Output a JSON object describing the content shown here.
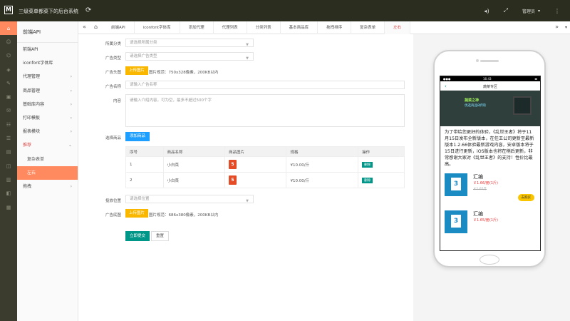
{
  "header": {
    "title": "三级菜单都菜下的后台系统",
    "user": "管理员"
  },
  "menu": {
    "heading": "前端API",
    "items": [
      {
        "label": "前端API",
        "chevron": false,
        "style": ""
      },
      {
        "label": "iconfont字体库",
        "chevron": false,
        "style": ""
      },
      {
        "label": "代理管理",
        "chevron": true,
        "style": ""
      },
      {
        "label": "商品管理",
        "chevron": true,
        "style": ""
      },
      {
        "label": "基础库内容",
        "chevron": true,
        "style": ""
      },
      {
        "label": "打印模板",
        "chevron": true,
        "style": ""
      },
      {
        "label": "报表模块",
        "chevron": true,
        "style": ""
      },
      {
        "label": "推荐",
        "chevron": true,
        "style": "red"
      },
      {
        "label": "复杂表单",
        "chevron": false,
        "style": "sub"
      },
      {
        "label": "左右",
        "chevron": false,
        "style": "selected"
      },
      {
        "label": "拖拽",
        "chevron": true,
        "style": ""
      }
    ]
  },
  "tabs": [
    {
      "label": "前端API",
      "active": false
    },
    {
      "label": "iconfont字体库",
      "active": false
    },
    {
      "label": "添加代理",
      "active": false
    },
    {
      "label": "代理列表",
      "active": false
    },
    {
      "label": "分类列表",
      "active": false
    },
    {
      "label": "基本商品库",
      "active": false
    },
    {
      "label": "拖拽排序",
      "active": false
    },
    {
      "label": "复杂表单",
      "active": false
    },
    {
      "label": "左右",
      "active": true
    }
  ],
  "form": {
    "category_label": "所属分类",
    "category_placeholder": "请选择所属分类",
    "ad_type_label": "广告类型",
    "ad_type_placeholder": "请选择广告类型",
    "header_img_label": "广告头图",
    "upload_label": "上传图片",
    "header_img_hint": "图片规范：750x328像素，200KB以内",
    "name_label": "广告名称",
    "name_placeholder": "请输入广告名称",
    "content_label": "内容",
    "content_placeholder": "请输入介绍内容，可为空，最多不超过500个字",
    "goods_label": "选择商品",
    "add_goods_button": "添加商品",
    "table_headers": [
      "序号",
      "商品名称",
      "商品图片",
      "规格",
      "操作"
    ],
    "rows": [
      {
        "index": "1",
        "name": "小白菜",
        "spec": "¥10.00/斤",
        "op": "删除"
      },
      {
        "index": "2",
        "name": "小白菜",
        "spec": "¥10.00/斤",
        "op": "删除"
      }
    ],
    "position_label": "投放位置",
    "position_placeholder": "请选择位置",
    "bottom_img_label": "广告底图",
    "bottom_upload_label": "上传图片",
    "bottom_img_hint": "图片规范：686x380像素，200KB以内",
    "submit_button": "立即提交",
    "reset_button": "重置"
  },
  "phone": {
    "time": "16:43",
    "nav_title": "蔬菜专区",
    "banner_line1": "蔬菜之神",
    "banner_line2": "优选商品8折购",
    "article": "为了带给您更好的体验，《乱世王者》将于11月15日发布全新版本，在任王公司更新至最新版本1.2.66体验最新游戏内容，安卓版本将于15日进行更新，iOS版本也将在稍后更新，非常感谢大家对《乱世王者》的支持！性价比最高。",
    "products": [
      {
        "name": "汇编",
        "price": "￥1.66/册(1斤)",
        "orig": "￥1.65斤",
        "buy": "去购买"
      },
      {
        "name": "汇编",
        "price": "￥1.65/册(1斤)",
        "orig": "",
        "buy": ""
      }
    ]
  }
}
